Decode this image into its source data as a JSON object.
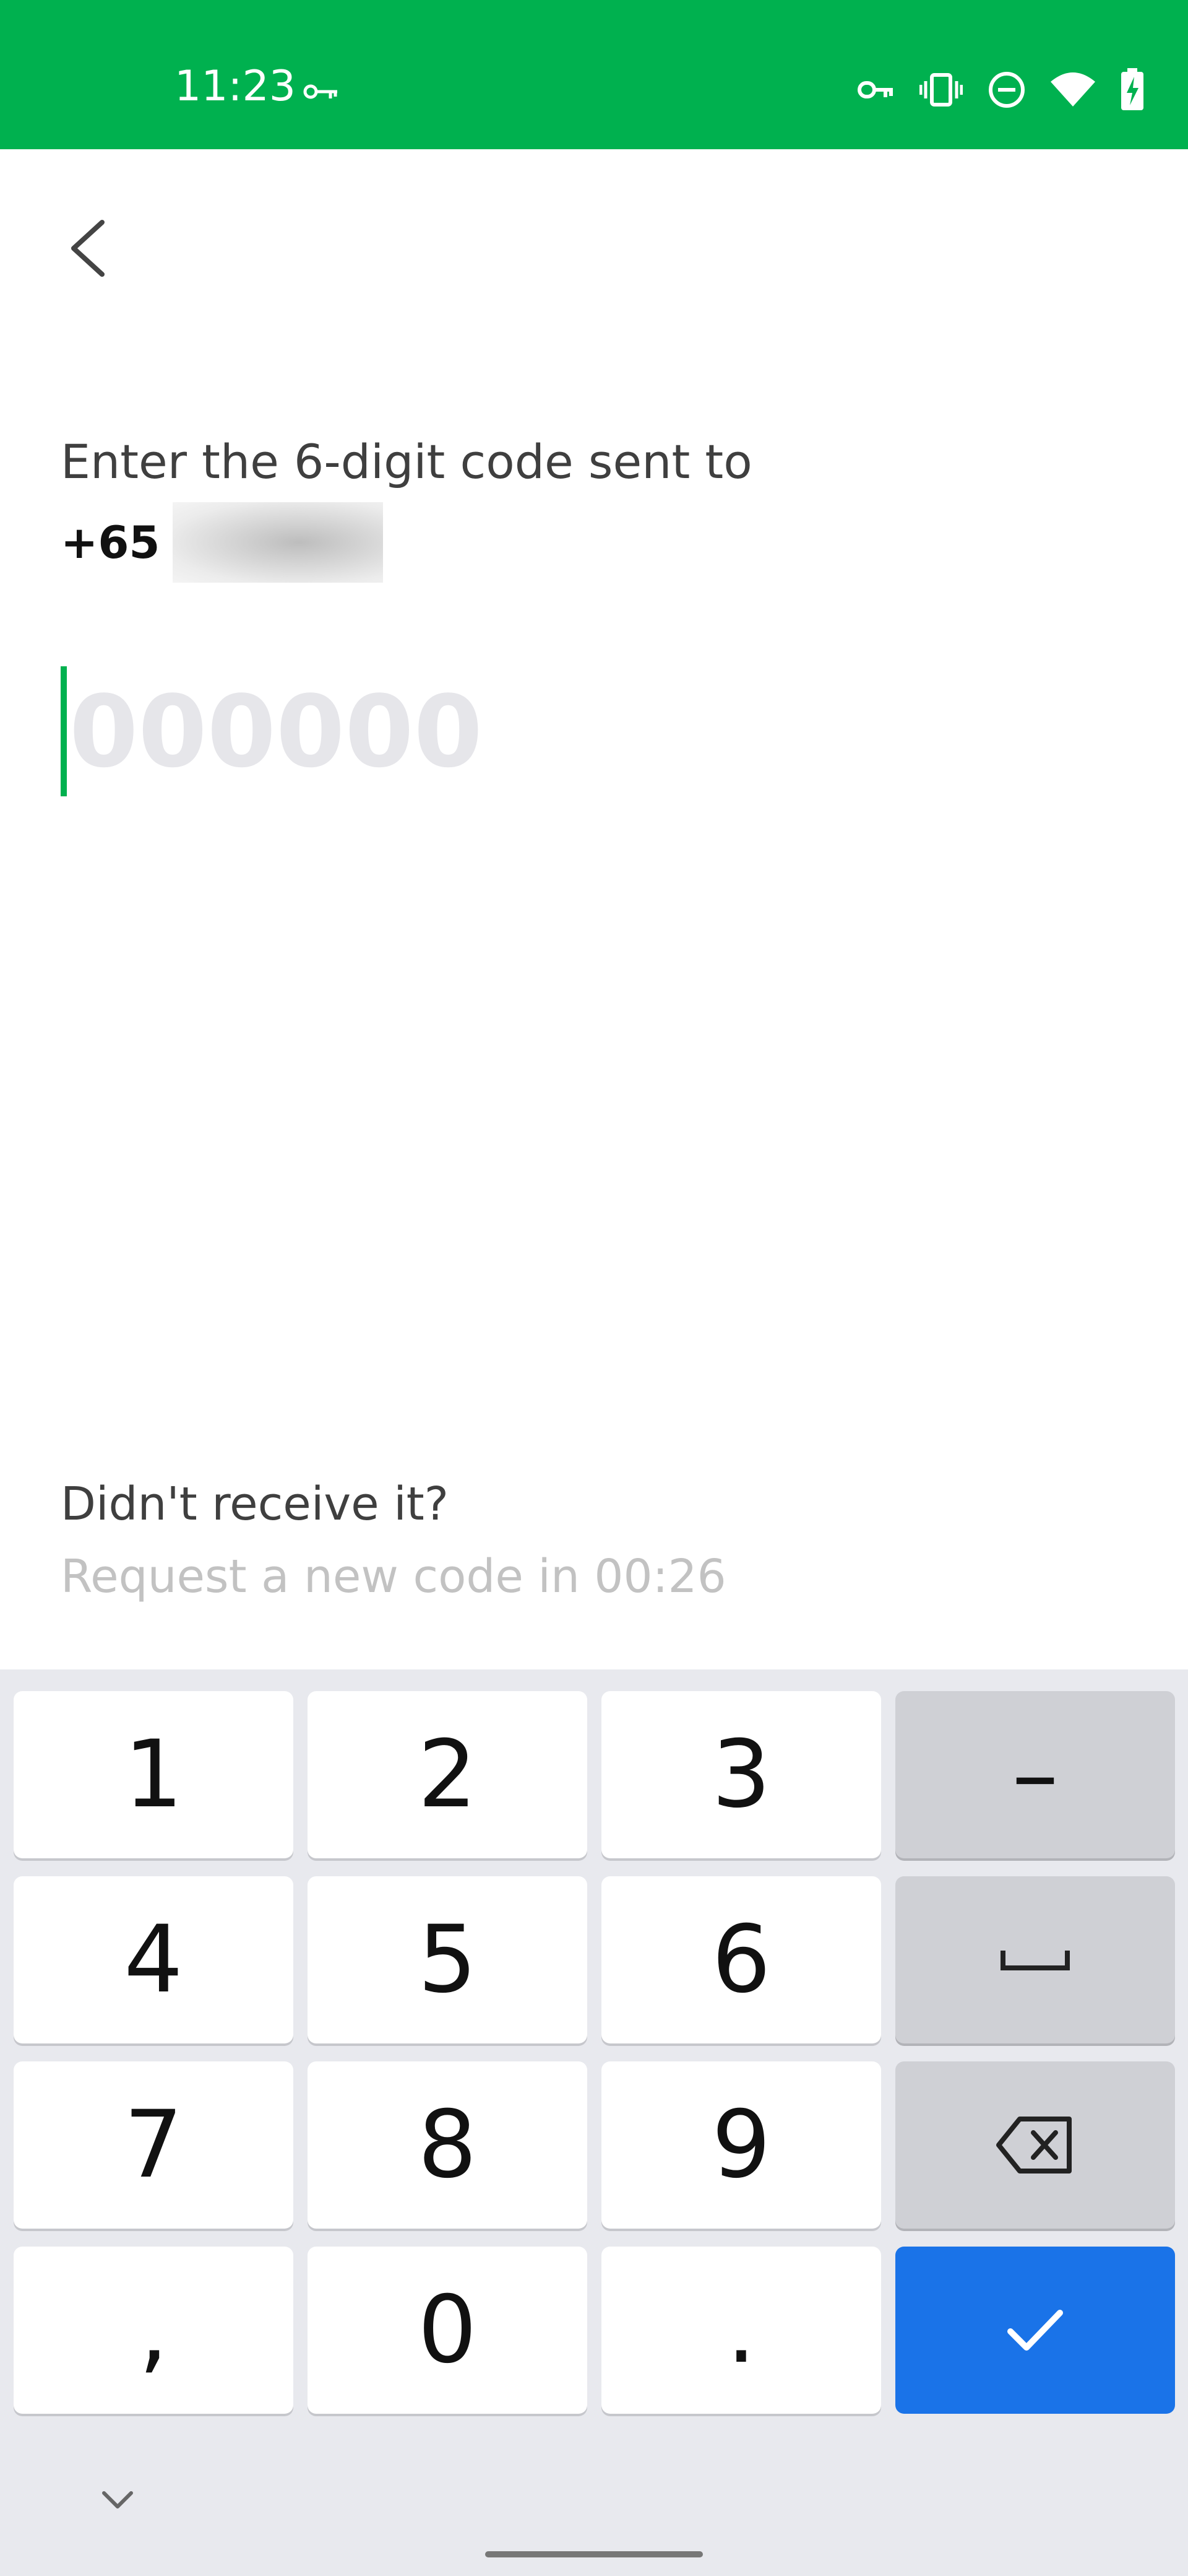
{
  "status_bar": {
    "time": "11:23",
    "background": "#00b14f",
    "left_icons": [
      "key-icon"
    ],
    "right_icons": [
      "vpn-key-icon",
      "vibrate-icon",
      "do-not-disturb-icon",
      "wifi-icon",
      "battery-charging-icon"
    ]
  },
  "screen": {
    "back_icon": "chevron-left-icon",
    "prompt": "Enter the 6-digit code sent to",
    "phone_prefix": "+65",
    "code_placeholder": "000000",
    "code_value": "",
    "accent_color": "#00b14f",
    "not_received": "Didn't receive it?",
    "resend_text": "Request a new code in 00:26"
  },
  "keyboard": {
    "rows": [
      [
        {
          "label": "1"
        },
        {
          "label": "2"
        },
        {
          "label": "3"
        },
        {
          "label": "–"
        }
      ],
      [
        {
          "label": "4"
        },
        {
          "label": "5"
        },
        {
          "label": "6"
        },
        {
          "label": "space-icon"
        }
      ],
      [
        {
          "label": "7"
        },
        {
          "label": "8"
        },
        {
          "label": "9"
        },
        {
          "label": "backspace-icon"
        }
      ],
      [
        {
          "label": ","
        },
        {
          "label": "0"
        },
        {
          "label": "."
        },
        {
          "label": "checkmark-icon"
        }
      ]
    ],
    "enter_color": "#1a73e8",
    "collapse_icon": "chevron-down-icon"
  }
}
